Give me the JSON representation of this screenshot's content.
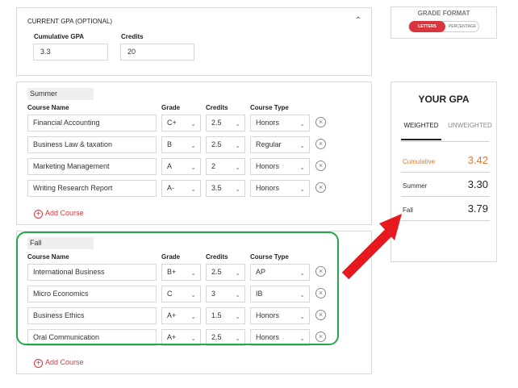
{
  "current_gpa": {
    "title": "CURRENT GPA (OPTIONAL)",
    "cumulative_label": "Cumulative GPA",
    "cumulative_value": "3.3",
    "credits_label": "Credits",
    "credits_value": "20"
  },
  "columns": {
    "course_name": "Course Name",
    "grade": "Grade",
    "credits": "Credits",
    "course_type": "Course Type"
  },
  "semesters": [
    {
      "name": "Summer",
      "courses": [
        {
          "name": "Financial Accounting",
          "grade": "C+",
          "credits": "2.5",
          "type": "Honors"
        },
        {
          "name": "Business Law & taxation",
          "grade": "B",
          "credits": "2.5",
          "type": "Regular"
        },
        {
          "name": "Marketing Management",
          "grade": "A",
          "credits": "2",
          "type": "Honors"
        },
        {
          "name": "Writing Research Report",
          "grade": "A-",
          "credits": "3.5",
          "type": "Honors"
        }
      ],
      "add_label": "Add Course"
    },
    {
      "name": "Fall",
      "courses": [
        {
          "name": "International Business",
          "grade": "B+",
          "credits": "2.5",
          "type": "AP"
        },
        {
          "name": "Micro Economics",
          "grade": "C",
          "credits": "3",
          "type": "IB"
        },
        {
          "name": "Business Ethics",
          "grade": "A+",
          "credits": "1.5",
          "type": "Honors"
        },
        {
          "name": "Oral Communication",
          "grade": "A+",
          "credits": "2.5",
          "type": "Honors"
        }
      ],
      "add_label": "Add Course"
    }
  ],
  "grade_format": {
    "title": "GRADE FORMAT",
    "options": [
      "LETTERS",
      "PERCENTAGE"
    ],
    "selected": "LETTERS"
  },
  "your_gpa": {
    "title": "YOUR GPA",
    "tabs": [
      "WEIGHTED",
      "UNWEIGHTED"
    ],
    "active_tab": "WEIGHTED",
    "rows": [
      {
        "label": "Cumulative",
        "value": "3.42"
      },
      {
        "label": "Summer",
        "value": "3.30"
      },
      {
        "label": "Fall",
        "value": "3.79"
      }
    ]
  },
  "icons": {
    "collapse": "chevron-up-icon",
    "dropdown": "chevron-down-icon",
    "remove": "circle-x-icon",
    "add": "circle-plus-icon",
    "annotation": "red-arrow-icon"
  },
  "colors": {
    "accent": "#d9353d",
    "highlight": "#e07a2e",
    "annotation_box": "#22a84a",
    "annotation_arrow": "#e8191e"
  }
}
